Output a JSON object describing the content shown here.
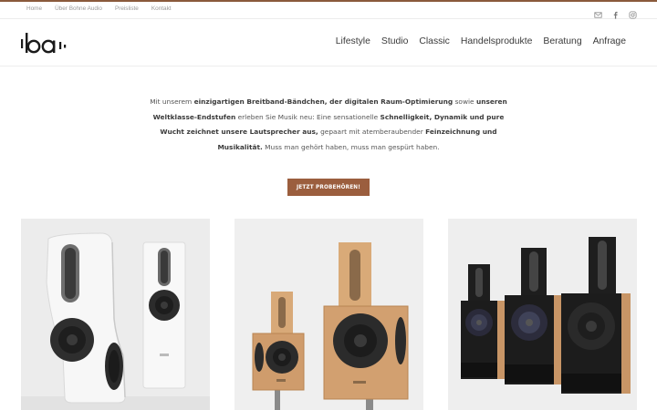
{
  "topbar": {
    "links": [
      "Home",
      "Über Bohne Audio",
      "Preisliste",
      "Kontakt"
    ],
    "social_icons": [
      "mail-icon",
      "facebook-icon",
      "instagram-icon"
    ]
  },
  "header": {
    "logo_text": "ıba·",
    "nav": [
      "Lifestyle",
      "Studio",
      "Classic",
      "Handelsprodukte",
      "Beratung",
      "Anfrage"
    ]
  },
  "intro": {
    "p1": "Mit unserem ",
    "b1": "einzigartigen Breitband-Bändchen, der digitalen Raum-Optimierung",
    "p2": " sowie ",
    "b2": "unseren Weltklasse-Endstufen",
    "p3": " erleben Sie Musik neu: Eine sensationelle ",
    "b3": "Schnelligkeit, Dynamik und pure Wucht zeichnet unsere Lautsprecher aus,",
    "p4": " gepaart mit atemberaubender ",
    "b4": "Feinzeichnung und Musikalität.",
    "p5": " Muss man gehört haben, muss man gespürt haben."
  },
  "cta": {
    "label": "JETZT PROBEHÖREN!"
  },
  "colors": {
    "accent": "#9b5e3e",
    "top_line": "#8a5a3c",
    "text": "#444444"
  },
  "products": [
    {
      "name": "white-speakers"
    },
    {
      "name": "wood-speakers"
    },
    {
      "name": "black-speakers"
    }
  ]
}
